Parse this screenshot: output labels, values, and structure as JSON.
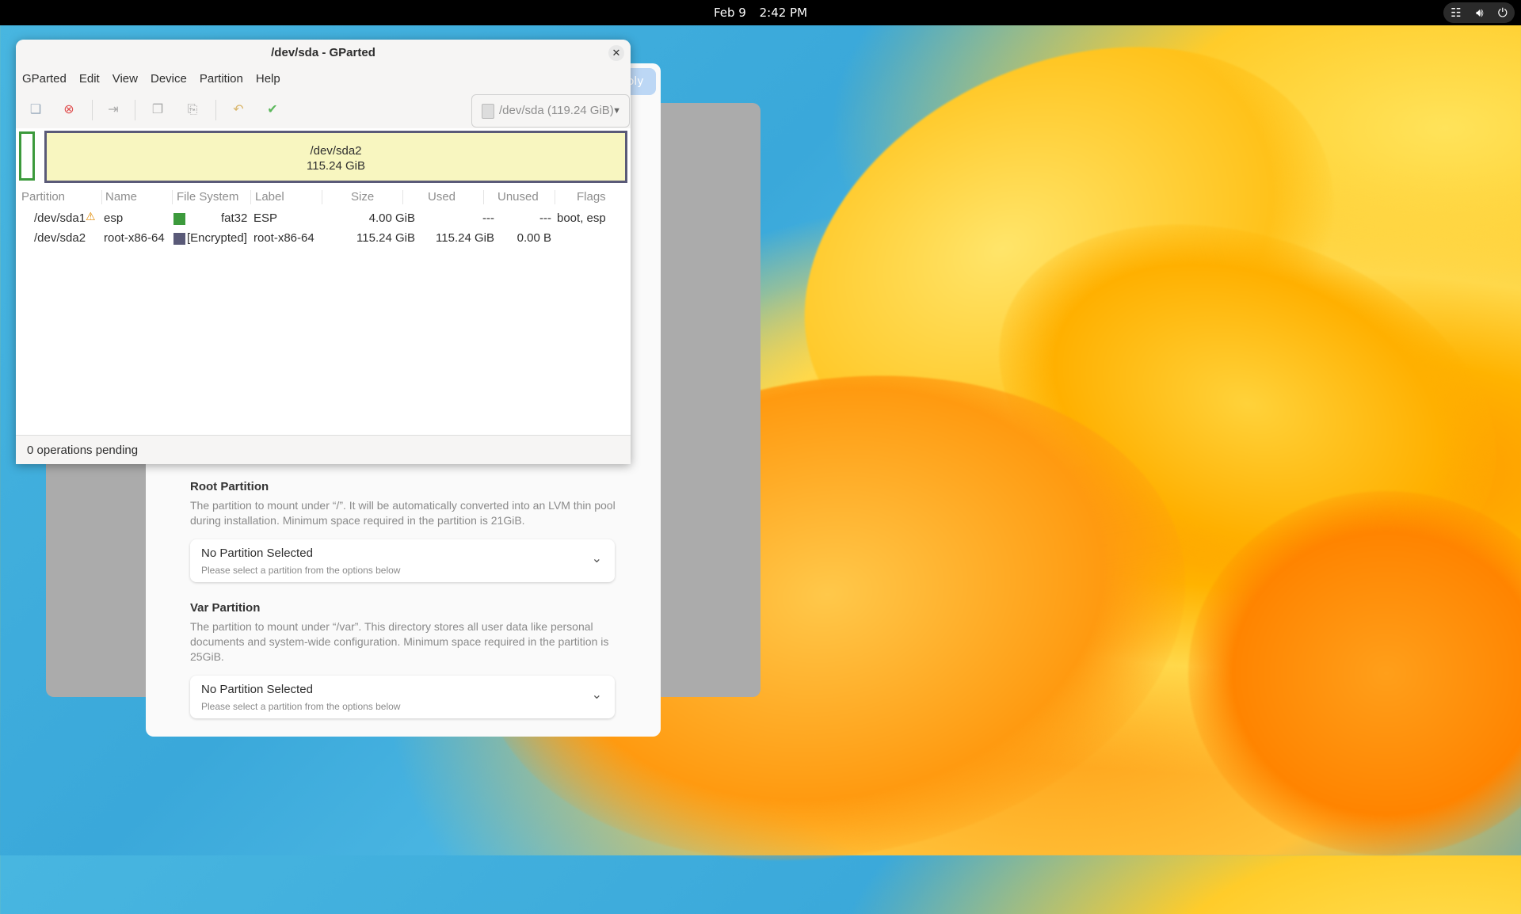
{
  "topbar": {
    "date": "Feb 9",
    "time": "2:42 PM"
  },
  "tray": {
    "network_icon": "network-icon",
    "volume_icon": "volume-icon",
    "power_icon": "power-icon"
  },
  "installer": {
    "apply_label": "ply",
    "root": {
      "title": "Root Partition",
      "desc": "The partition to mount under “/”. It will be automatically converted into an LVM thin pool during installation. Minimum space required in the partition is 21GiB.",
      "value": "No Partition Selected",
      "hint": "Please select a partition from the options below"
    },
    "var": {
      "title": "Var Partition",
      "desc": "The partition to mount under “/var”. This directory stores all user data like personal documents and system-wide configuration. Minimum space required in the partition is 25GiB.",
      "value": "No Partition Selected",
      "hint": "Please select a partition from the options below"
    }
  },
  "gparted": {
    "title": "/dev/sda - GParted",
    "menu": [
      "GParted",
      "Edit",
      "View",
      "Device",
      "Partition",
      "Help"
    ],
    "device": "/dev/sda (119.24 GiB)",
    "graph": {
      "name": "/dev/sda2",
      "size": "115.24 GiB"
    },
    "columns": [
      "Partition",
      "Name",
      "File System",
      "Label",
      "Size",
      "Used",
      "Unused",
      "Flags"
    ],
    "rows": [
      {
        "partition": "/dev/sda1",
        "name": "esp",
        "fs": "fat32",
        "fs_color": "#3c9a3c",
        "label": "ESP",
        "size": "4.00 GiB",
        "used": "---",
        "unused": "---",
        "flags": "boot, esp",
        "warning": true
      },
      {
        "partition": "/dev/sda2",
        "name": "root-x86-64",
        "fs": "[Encrypted]",
        "fs_color": "#5a5a78",
        "label": "root-x86-64",
        "size": "115.24 GiB",
        "used": "115.24 GiB",
        "unused": "0.00 B",
        "flags": "",
        "warning": false
      }
    ],
    "status": "0 operations pending"
  }
}
